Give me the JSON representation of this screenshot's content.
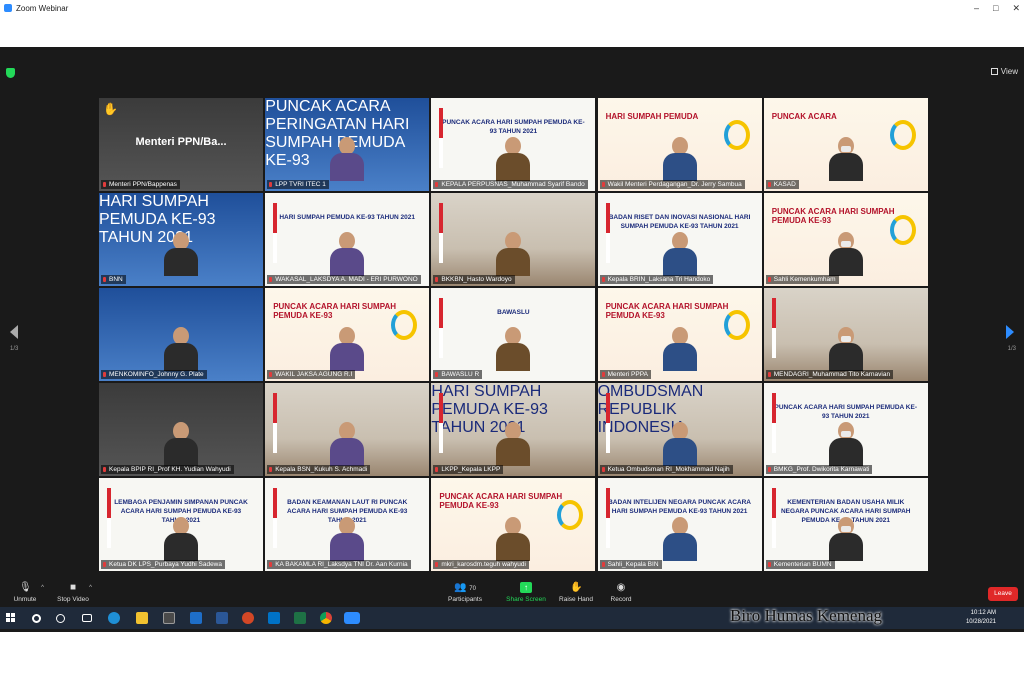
{
  "window": {
    "title": "Zoom Webinar",
    "minimize": "–",
    "maximize": "□",
    "close": "✕"
  },
  "topbar": {
    "view_label": "View"
  },
  "tiles": [
    {
      "name": "Menteri PPN/Bappenas",
      "big_name": "Menteri  PPN/Ba...",
      "hand": "✋",
      "scene": "dark"
    },
    {
      "name": "LPP TVRI ITEC 1",
      "scene": "blue",
      "banner": "PUNCAK ACARA PERINGATAN HARI SUMPAH PEMUDA KE-93"
    },
    {
      "name": "KEPALA PERPUSNAS_Muhammad Syarif Bando",
      "scene": "white",
      "banner": "PUNCAK ACARA HARI SUMPAH PEMUDA KE-93 TAHUN 2021"
    },
    {
      "name": "Wakil Menteri Perdagangan_Dr. Jerry Sambua",
      "scene": "banner",
      "banner": "HARI SUMPAH PEMUDA"
    },
    {
      "name": "KASAD",
      "scene": "banner",
      "banner": "PUNCAK ACARA"
    },
    {
      "name": "BNN",
      "scene": "blue",
      "banner": "HARI SUMPAH PEMUDA KE-93 TAHUN 2021"
    },
    {
      "name": "WAKASAL_LAKSDYA A. MADI - ERI PURWONO",
      "scene": "white",
      "banner": "HARI SUMPAH PEMUDA KE-93 TAHUN 2021"
    },
    {
      "name": "BKKBN_Hasto Wardoyo",
      "scene": "room"
    },
    {
      "name": "Kepala BRIN_Laksana Tri Handoko",
      "scene": "white",
      "banner": "BADAN RISET DAN INOVASI NASIONAL HARI SUMPAH PEMUDA KE-93 TAHUN 2021"
    },
    {
      "name": "Sahli Kemenkumham",
      "scene": "banner",
      "banner": "PUNCAK ACARA HARI SUMPAH PEMUDA KE-93"
    },
    {
      "name": "MENKOMINFO_Johnny G. Plate",
      "scene": "blue"
    },
    {
      "name": "WAKIL JAKSA AGUNG R.I",
      "scene": "banner",
      "banner": "PUNCAK ACARA HARI SUMPAH PEMUDA KE-93"
    },
    {
      "name": "BAWASLU R",
      "scene": "white",
      "banner": "BAWASLU"
    },
    {
      "name": "Menteri PPPA",
      "scene": "banner",
      "banner": "PUNCAK ACARA HARI SUMPAH PEMUDA KE-93"
    },
    {
      "name": "MENDAGRI_Muhammad Tito Karnavian",
      "scene": "room"
    },
    {
      "name": "Kepala BPIP RI_Prof KH. Yudian Wahyudi",
      "scene": "dark"
    },
    {
      "name": "Kepala BSN_Kukuh S. Achmadi",
      "scene": "room"
    },
    {
      "name": "LKPP_Kepala LKPP",
      "scene": "room",
      "banner": "HARI SUMPAH PEMUDA KE-93 TAHUN 2021"
    },
    {
      "name": "Ketua Ombudsman RI_Mokhammad Najih",
      "scene": "room",
      "banner": "OMBUDSMAN REPUBLIK INDONESIA"
    },
    {
      "name": "BMKG_Prof. Dwikorita Karnawati",
      "scene": "white",
      "banner": "PUNCAK ACARA HARI SUMPAH PEMUDA KE-93 TAHUN 2021"
    },
    {
      "name": "Ketua DK LPS_Purbaya Yudhi Sadewa",
      "scene": "white",
      "banner": "LEMBAGA PENJAMIN SIMPANAN PUNCAK ACARA HARI SUMPAH PEMUDA KE-93 TAHUN 2021"
    },
    {
      "name": "KA BAKAMLA RI_Laksdya TNI Dr. Aan Kurnia",
      "scene": "white",
      "banner": "BADAN KEAMANAN LAUT RI PUNCAK ACARA HARI SUMPAH PEMUDA KE-93 TAHUN 2021"
    },
    {
      "name": "mkri_karosdm.teguh wahyudi",
      "scene": "banner",
      "banner": "PUNCAK ACARA HARI SUMPAH PEMUDA KE-93"
    },
    {
      "name": "Sahli_Kepala BIN",
      "scene": "white",
      "banner": "BADAN INTELIJEN NEGARA PUNCAK ACARA HARI SUMPAH PEMUDA KE-93 TAHUN 2021"
    },
    {
      "name": "Kementerian BUMN",
      "scene": "white",
      "banner": "KEMENTERIAN BADAN USAHA MILIK NEGARA PUNCAK ACARA HARI SUMPAH PEMUDA KE-93 TAHUN 2021"
    }
  ],
  "pagination": {
    "left": "1/3",
    "right": "1/3"
  },
  "controls": {
    "unmute": "Unmute",
    "stop_video": "Stop Video",
    "participants": "Participants",
    "participants_count": "70",
    "share_screen": "Share Screen",
    "raise_hand": "Raise Hand",
    "record": "Record",
    "leave": "Leave"
  },
  "taskbar": {
    "time": "10:12 AM",
    "date": "10/28/2021"
  },
  "watermark": "Biro Humas Kemenag",
  "colors": {
    "zoom_blue": "#2d8cff",
    "share_green": "#23d959",
    "leave_red": "#e02828",
    "active_speaker": "#e6e34a"
  }
}
